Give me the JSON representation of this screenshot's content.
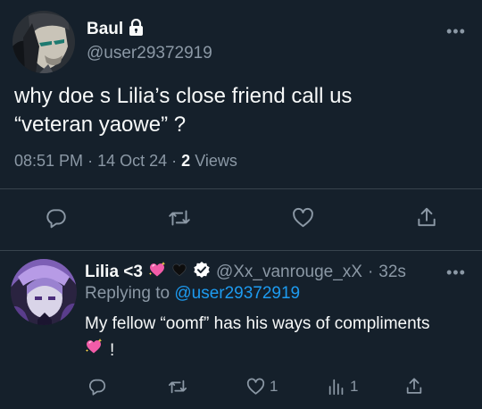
{
  "tweet": {
    "author_name": "Baul",
    "author_handle": "@user29372919",
    "text": "why doe s Lilia’s close friend call us\n“veteran yaowe” ?",
    "time": "08:51 PM",
    "separator": "·",
    "date": "14 Oct 24",
    "views_count": "2",
    "views_label": "Views"
  },
  "reply": {
    "author_name": "Lilia <3",
    "author_handle": "@Xx_vanrouge_xX",
    "separator": "·",
    "age": "32s",
    "replying_prefix": "Replying to",
    "replying_handle": "@user29372919",
    "text_line1": "My fellow “oomf” has his ways of compliments",
    "text_line2": "!",
    "like_count": "1",
    "views_count": "1"
  },
  "more_glyph": "•••",
  "colors": {
    "background": "#15202b",
    "primary_text": "#f7f9f9",
    "secondary_text": "#8b98a5",
    "link": "#1d9bf0",
    "divider": "#38444d",
    "verified_badge": "#ffffff"
  },
  "icons": {
    "lock": "lock-icon",
    "reply": "reply-icon",
    "retweet": "retweet-icon",
    "like": "heart-icon",
    "share": "share-icon",
    "views": "analytics-icon",
    "verified": "verified-badge-icon",
    "emoji_sparkling_heart": "sparkling-heart-emoji",
    "emoji_black_heart": "black-heart-emoji"
  }
}
